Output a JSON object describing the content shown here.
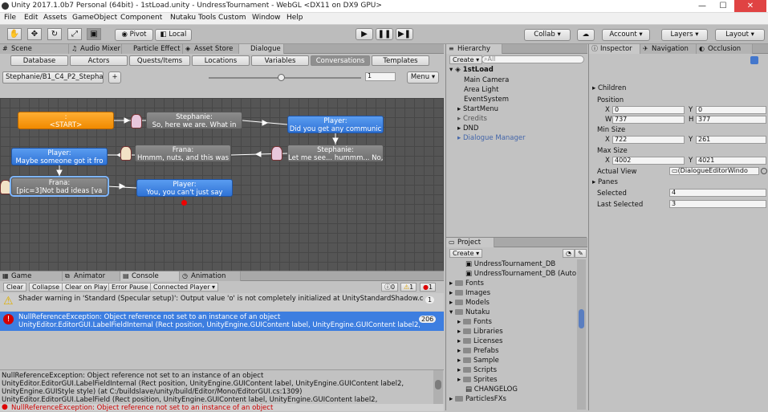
{
  "window": {
    "title": "Unity 2017.1.0b7 Personal (64bit) - 1stLoad.unity - UndressTournament - WebGL <DX11 on DX9 GPU>",
    "minimize": "—",
    "maximize": "☐",
    "close": "✕"
  },
  "menu": [
    "File",
    "Edit",
    "Assets",
    "GameObject",
    "Component",
    "Nutaku Tools",
    "Custom",
    "Window",
    "Help"
  ],
  "toolbar": {
    "pivot": "Pivot",
    "local": "Local",
    "collab": "Collab ▾",
    "account": "Account ▾",
    "layers": "Layers ▾",
    "layout": "Layout ▾"
  },
  "scene_tabs": [
    "Scene",
    "Audio Mixer",
    "Particle Effect",
    "Asset Store",
    "Dialogue"
  ],
  "dialogue_tabs": [
    "Database",
    "Actors",
    "Quests/Items",
    "Locations",
    "Variables",
    "Conversations",
    "Templates"
  ],
  "conversation": {
    "selector": "Stephanie/B1_C4_P2_Stephait",
    "add": "+",
    "zoom_value": "1",
    "menu": "Menu ▾"
  },
  "nodes": [
    {
      "title": ":",
      "text": "<START>"
    },
    {
      "title": "Stephanie:",
      "text": "So, here we are. What in"
    },
    {
      "title": "Player:",
      "text": "Did you get any communic"
    },
    {
      "title": "Stephanie:",
      "text": "Let me see... hummm... No,"
    },
    {
      "title": "Frana:",
      "text": "Hmmm, nuts, and this was"
    },
    {
      "title": "Player:",
      "text": "Maybe someone got it fro"
    },
    {
      "title": "Frana:",
      "text": "[pic=3]Not bad ideas [va"
    },
    {
      "title": "Player:",
      "text": "You, you can't just say"
    }
  ],
  "console_tabs": [
    "Game",
    "Animator",
    "Console",
    "Animation"
  ],
  "console_buttons": [
    "Clear",
    "Collapse",
    "Clear on Play",
    "Error Pause",
    "Connected Player ▾"
  ],
  "console_counts": {
    "info": "0",
    "warn": "1",
    "error": "1"
  },
  "logs": [
    {
      "line1": "Shader warning in 'Standard (Specular setup)': Output value 'o' is not completely initialized at UnityStandardShadow.cginc",
      "line2": "",
      "count": "1"
    },
    {
      "line1": "NullReferenceException: Object reference not set to an instance of an object",
      "line2": "UnityEditor.EditorGUI.LabelFieldInternal (Rect position, UnityEngine.GUIContent label, UnityEngine.GUIContent label2, Unity",
      "count": "206"
    }
  ],
  "detail": [
    "NullReferenceException: Object reference not set to an instance of an object",
    "UnityEditor.EditorGUI.LabelFieldInternal (Rect position, UnityEngine.GUIContent label, UnityEngine.GUIContent label2,",
    "UnityEngine.GUIStyle style) (at C:/buildslave/unity/build/Editor/Mono/EditorGUI.cs:1309)",
    "UnityEditor.EditorGUI.LabelField (Rect position, UnityEngine.GUIContent label, UnityEngine.GUIContent label2,"
  ],
  "statusbar": "NullReferenceException: Object reference not set to an instance of an object",
  "hierarchy": {
    "tab": "Hierarchy",
    "create": "Create ▾",
    "search": "All",
    "scene": "1stLoad",
    "items": [
      "Main Camera",
      "Area Light",
      "EventSystem",
      "StartMenu",
      "Credits",
      "DND",
      "Dialogue Manager"
    ]
  },
  "project": {
    "tab": "Project",
    "create": "Create ▾",
    "items": [
      "UndressTournament_DB",
      "UndressTournament_DB (Auto",
      "Fonts",
      "Images",
      "Models",
      "Nutaku",
      "Fonts",
      "Libraries",
      "Licenses",
      "Prefabs",
      "Sample",
      "Scripts",
      "Sprites",
      "CHANGELOG",
      "ParticlesFXs"
    ]
  },
  "inspector": {
    "tabs": [
      "Inspector",
      "Navigation",
      "Occlusion"
    ],
    "children": "Children",
    "position": "Position",
    "x0": "0",
    "y0": "0",
    "w": "737",
    "h": "377",
    "minsize": "Min Size",
    "minx": "722",
    "miny": "261",
    "maxsize": "Max Size",
    "maxx": "4002",
    "maxy": "4021",
    "actualview": "Actual View",
    "actualval": "(DialogueEditorWindo",
    "panes": "Panes",
    "selected": "Selected",
    "selectedval": "4",
    "lastselected": "Last Selected",
    "lastval": "3",
    "lx": "X",
    "ly": "Y",
    "lw": "W",
    "lh": "H"
  }
}
